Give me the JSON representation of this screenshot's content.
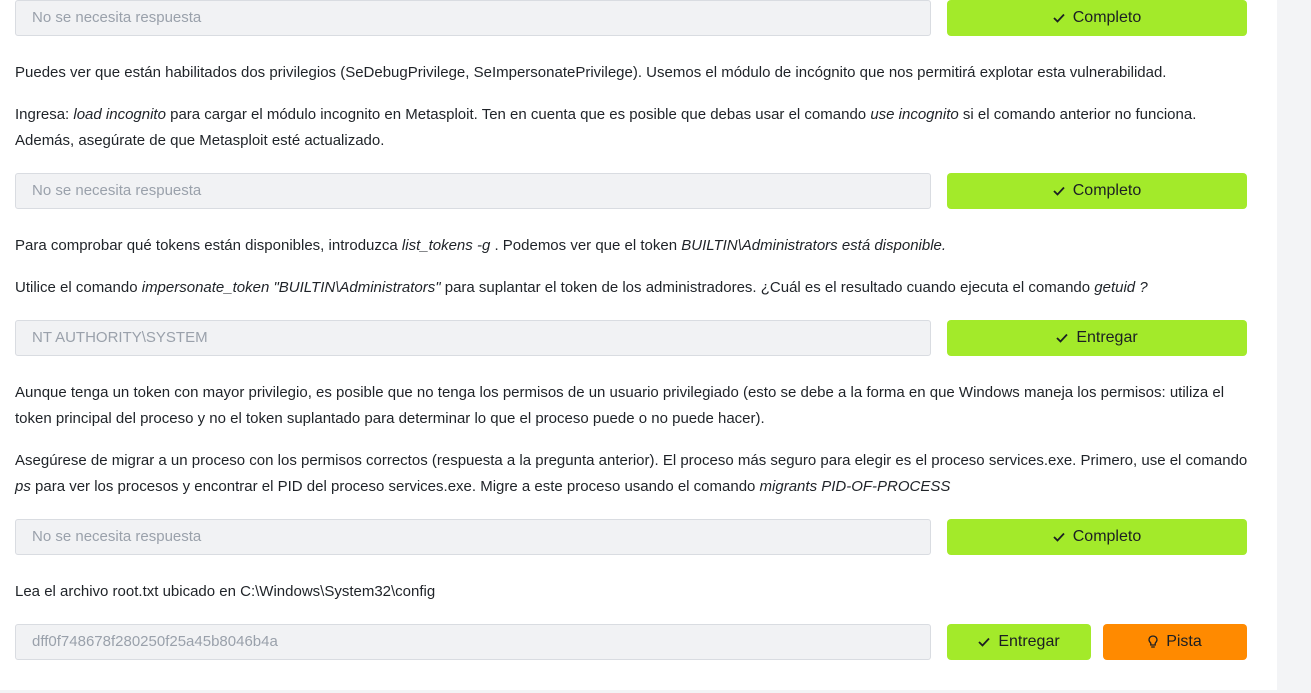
{
  "placeholder_no_answer": "No se necesita respuesta",
  "btn_complete": "Completo",
  "btn_submit": "Entregar",
  "btn_hint": "Pista",
  "para1": "Puedes ver que están habilitados dos privilegios (SeDebugPrivilege, SeImpersonatePrivilege). Usemos el módulo de incógnito que nos permitirá explotar esta vulnerabilidad.",
  "para2": {
    "t1": "Ingresa: ",
    "cmd1": "load incognito",
    "t2": " para cargar el módulo incognito en Metasploit. Ten en cuenta que es posible que debas usar el comando ",
    "cmd2": "use incognito",
    "t3": " si el comando anterior no funciona. Además, asegúrate de que Metasploit esté actualizado."
  },
  "para3": {
    "t1": "Para comprobar qué tokens están disponibles, introduzca ",
    "cmd1": "list_tokens -g",
    "t2": " . Podemos ver que el token ",
    "cmd2": "BUILTIN\\Administrators está disponible."
  },
  "para4": {
    "t1": "Utilice el  comando ",
    "cmd1": "impersonate_token \"BUILTIN\\Administrators\"",
    "t2": " para suplantar el token de los administradores. ¿Cuál es el resultado cuando ejecuta el comando ",
    "cmd2": "getuid ?"
  },
  "answer3": "NT AUTHORITY\\SYSTEM",
  "para5": "Aunque tenga un token con mayor privilegio, es posible que no tenga los permisos de un usuario privilegiado (esto se debe a la forma en que Windows maneja los permisos: utiliza el token principal del proceso y no el token suplantado para determinar lo que el proceso puede o no puede hacer).",
  "para6": {
    "t1": "Asegúrese de migrar a un proceso con los permisos correctos (respuesta a la pregunta anterior). El proceso más seguro para elegir es el proceso services.exe. Primero, use el comando ",
    "cmd1": "ps",
    "t2": " para ver los procesos y encontrar el PID del proceso services.exe. Migre a este proceso usando el comando ",
    "cmd2": "migrants PID-OF-PROCESS"
  },
  "para7": "Lea el archivo root.txt ubicado en C:\\Windows\\System32\\config",
  "answer5": "dff0f748678f280250f25a45b8046b4a",
  "colors": {
    "accent_green": "#a3ea2a",
    "hint_orange": "#ff8a00"
  }
}
